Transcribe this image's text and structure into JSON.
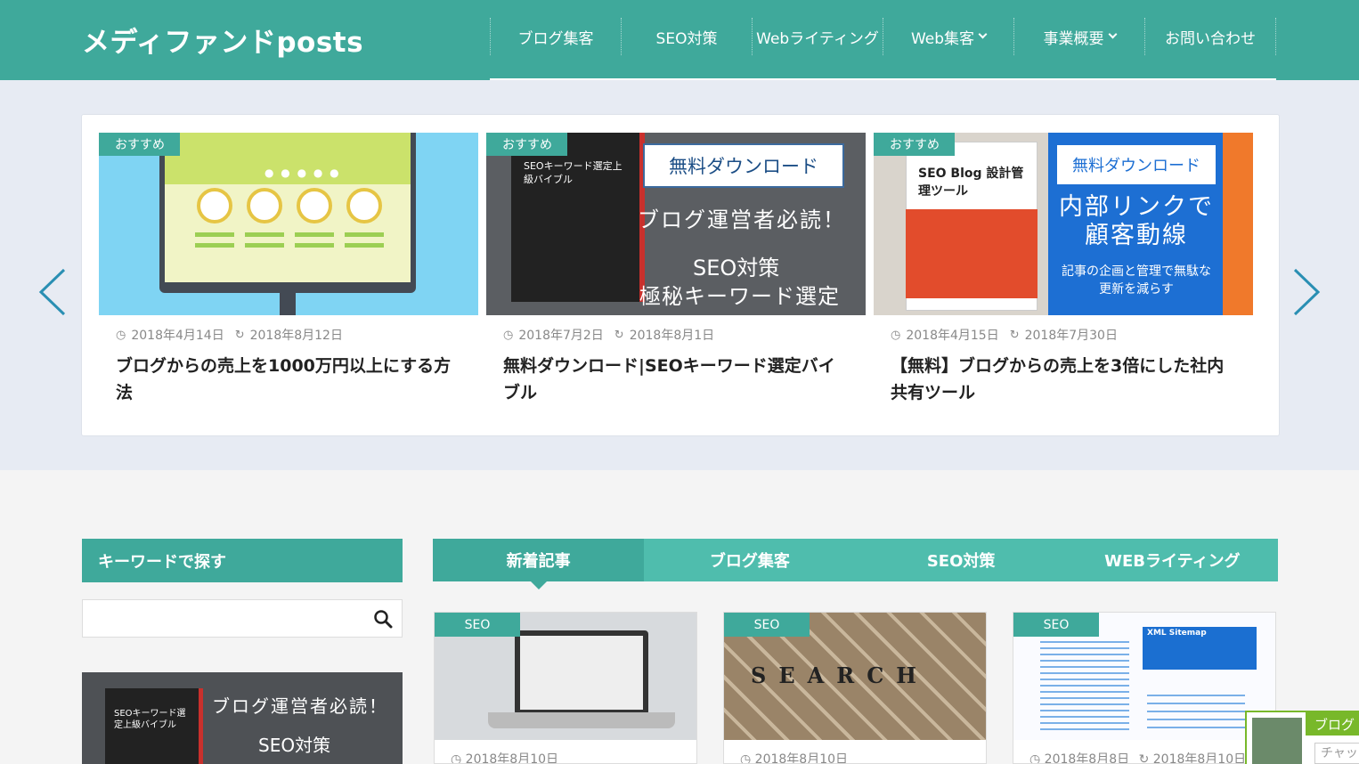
{
  "header": {
    "logo": "メディファンドposts",
    "nav": [
      {
        "label": "ブログ集客"
      },
      {
        "label": "SEO対策"
      },
      {
        "label": "Webライティング"
      },
      {
        "label": "Web集客",
        "dropdown": true
      },
      {
        "label": "事業概要",
        "dropdown": true
      },
      {
        "label": "お問い合わせ"
      }
    ]
  },
  "carousel": {
    "prev_icon": "chevron-left-icon",
    "next_icon": "chevron-right-icon",
    "cards": [
      {
        "badge": "おすすめ",
        "published": "2018年4月14日",
        "updated": "2018年8月12日",
        "title": "ブログからの売上を1000万円以上にする方法"
      },
      {
        "badge": "おすすめ",
        "published": "2018年7月2日",
        "updated": "2018年8月1日",
        "title": "無料ダウンロード|SEOキーワード選定バイブル",
        "image_text": {
          "box": "無料ダウンロード",
          "line1": "ブログ運営者必読！",
          "line2": "SEO対策",
          "line3": "極秘キーワード選定",
          "book": "SEOキーワード選定上級バイブル"
        }
      },
      {
        "badge": "おすすめ",
        "published": "2018年4月15日",
        "updated": "2018年7月30日",
        "title": "【無料】ブログからの売上を3倍にした社内共有ツール",
        "image_text": {
          "box": "無料ダウンロード",
          "line1": "内部リンクで顧客動線",
          "line2": "記事の企画と管理で無駄な更新を減らす",
          "book": "SEO Blog 設計管理ツール"
        }
      }
    ]
  },
  "sidebar": {
    "heading": "キーワードで探す",
    "search_placeholder": "",
    "banner": {
      "line1": "ブログ運営者必読！",
      "line2": "SEO対策",
      "book": "SEOキーワード選定上級バイブル"
    }
  },
  "tabs": [
    {
      "label": "新着記事",
      "active": true
    },
    {
      "label": "ブログ集客",
      "active": false
    },
    {
      "label": "SEO対策",
      "active": false
    },
    {
      "label": "WEBライティング",
      "active": false
    }
  ],
  "posts": [
    {
      "badge": "SEO",
      "published": "2018年8月10日"
    },
    {
      "badge": "SEO",
      "published": "2018年8月10日",
      "image_text": "SEARCH"
    },
    {
      "badge": "SEO",
      "published": "2018年8月8日",
      "updated": "2018年8月10日",
      "image_text": "XML Sitemap"
    }
  ],
  "chat": {
    "title": "ブログ",
    "input_placeholder": "チャッ"
  },
  "colors": {
    "brand": "#3fa99b",
    "tab_bg": "#4fbdad",
    "carousel_bg": "#e7ebf3",
    "chat_green": "#78b82a"
  }
}
